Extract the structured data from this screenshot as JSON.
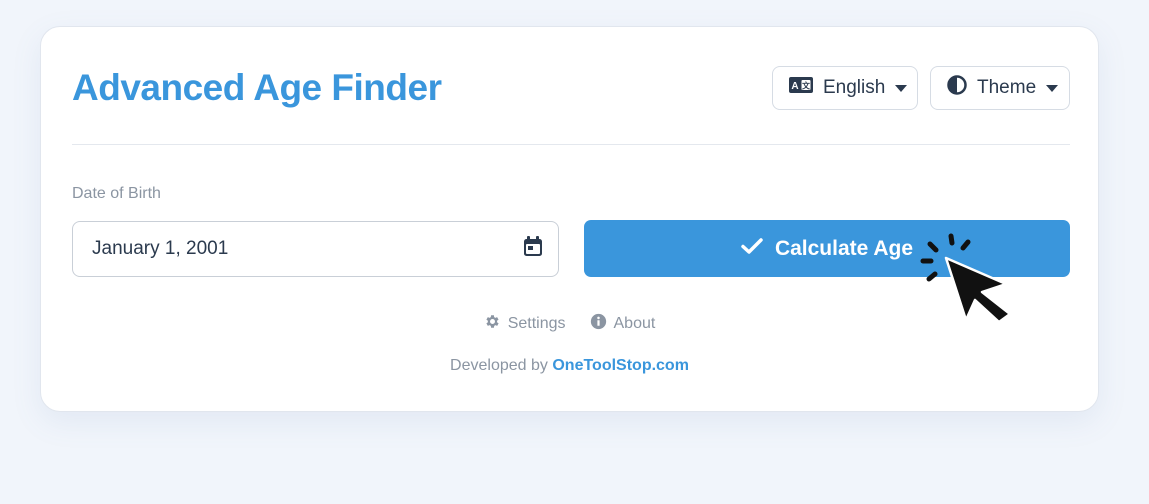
{
  "app": {
    "title": "Advanced Age Finder"
  },
  "header": {
    "language_label": "English",
    "theme_label": "Theme"
  },
  "form": {
    "dob_label": "Date of Birth",
    "dob_value": "January 1, 2001",
    "calculate_label": "Calculate Age"
  },
  "links": {
    "settings_label": "Settings",
    "about_label": "About"
  },
  "footer": {
    "prefix": "Developed by",
    "link_text": "OneToolStop.com"
  },
  "icons": {
    "language": "language-icon",
    "theme": "contrast-icon",
    "calendar": "calendar-icon",
    "check": "check-icon",
    "settings": "gear-icon",
    "about": "info-icon",
    "cursor": "click-cursor-icon"
  },
  "colors": {
    "accent": "#3a96dc",
    "text": "#2b3a4e",
    "muted": "#8b95a2",
    "background": "#f1f5fb"
  }
}
